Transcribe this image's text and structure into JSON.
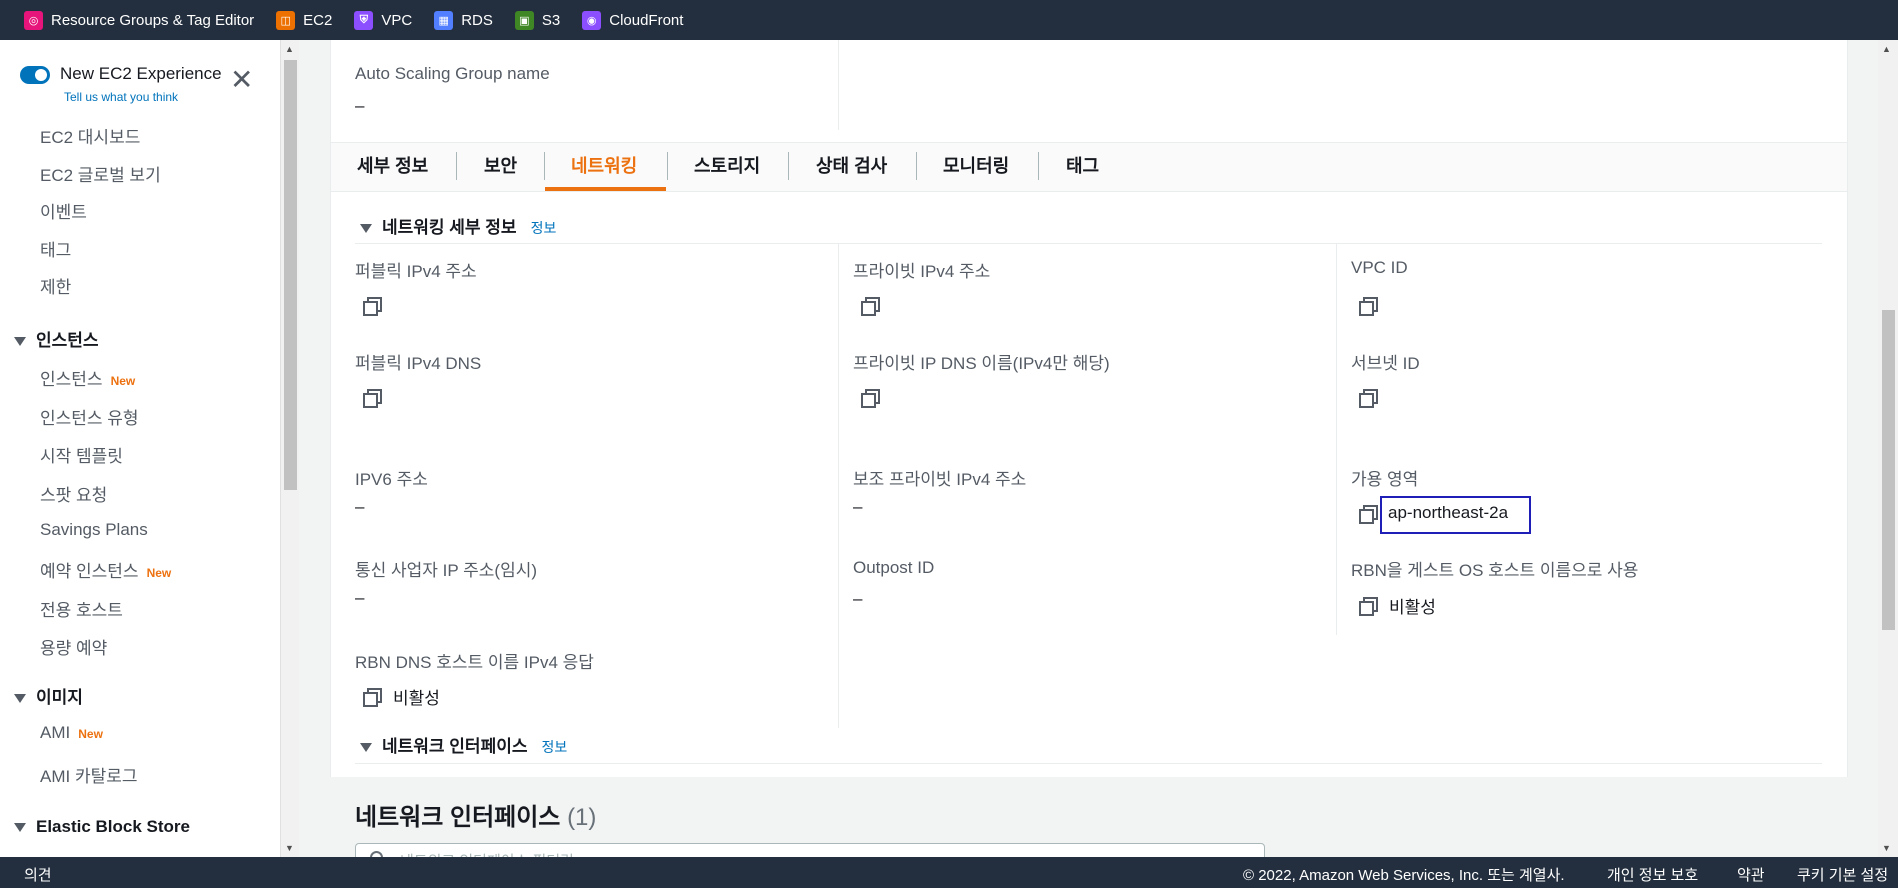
{
  "topbar": {
    "favorites": [
      {
        "label": "Resource Groups & Tag Editor",
        "icon": "resource-groups-icon",
        "color": "#e7157b",
        "glyph": "◎"
      },
      {
        "label": "EC2",
        "icon": "ec2-icon",
        "color": "#ed7100",
        "glyph": "◫"
      },
      {
        "label": "VPC",
        "icon": "vpc-icon",
        "color": "#8c4fff",
        "glyph": "⛨"
      },
      {
        "label": "RDS",
        "icon": "rds-icon",
        "color": "#527fff",
        "glyph": "▦"
      },
      {
        "label": "S3",
        "icon": "s3-icon",
        "color": "#3f8624",
        "glyph": "▣"
      },
      {
        "label": "CloudFront",
        "icon": "cloudfront-icon",
        "color": "#8c4fff",
        "glyph": "◉"
      }
    ]
  },
  "sidebar": {
    "new_experience": {
      "title": "New EC2 Experience",
      "link": "Tell us what you think"
    },
    "items_top": [
      "EC2 대시보드",
      "EC2 글로벌 보기",
      "이벤트",
      "태그",
      "제한"
    ],
    "section_instances": "인스턴스",
    "instances_items": [
      {
        "label": "인스턴스",
        "badge": "New"
      },
      {
        "label": "인스턴스 유형",
        "badge": ""
      },
      {
        "label": "시작 템플릿",
        "badge": ""
      },
      {
        "label": "스팟 요청",
        "badge": ""
      },
      {
        "label": "Savings Plans",
        "badge": ""
      },
      {
        "label": "예약 인스턴스",
        "badge": "New"
      },
      {
        "label": "전용 호스트",
        "badge": ""
      },
      {
        "label": "용량 예약",
        "badge": ""
      }
    ],
    "section_images": "이미지",
    "images_items": [
      {
        "label": "AMI",
        "badge": "New"
      },
      {
        "label": "AMI 카탈로그",
        "badge": ""
      }
    ],
    "section_ebs": "Elastic Block Store"
  },
  "main": {
    "asg_label": "Auto Scaling Group name",
    "asg_value": "–",
    "tabs": [
      "세부 정보",
      "보안",
      "네트워킹",
      "스토리지",
      "상태 검사",
      "모니터링",
      "태그"
    ],
    "active_tab": "네트워킹",
    "networking_section": {
      "title": "네트워킹 세부 정보",
      "info": "정보"
    },
    "fields": {
      "public_ipv4": {
        "label": "퍼블릭 IPv4 주소"
      },
      "private_ipv4": {
        "label": "프라이빗 IPv4 주소"
      },
      "vpc_id": {
        "label": "VPC ID"
      },
      "public_dns": {
        "label": "퍼블릭 IPv4 DNS"
      },
      "private_dns": {
        "label": "프라이빗 IP DNS 이름(IPv4만 해당)"
      },
      "subnet_id": {
        "label": "서브넷 ID"
      },
      "ipv6": {
        "label": "IPV6 주소",
        "value": "–"
      },
      "secondary_private": {
        "label": "보조 프라이빗 IPv4 주소",
        "value": "–"
      },
      "az": {
        "label": "가용 영역",
        "value": "ap-northeast-2a"
      },
      "carrier_ip": {
        "label": "통신 사업자 IP 주소(임시)",
        "value": "–"
      },
      "outpost": {
        "label": "Outpost ID",
        "value": "–"
      },
      "rbn_guest": {
        "label": "RBN을 게스트 OS 호스트 이름으로 사용",
        "value": "비활성"
      },
      "rbn_dns": {
        "label": "RBN DNS 호스트 이름 IPv4 응답",
        "value": "비활성"
      }
    },
    "interfaces_section": {
      "title": "네트워크 인터페이스",
      "info": "정보"
    },
    "ni_title": "네트워크 인터페이스",
    "ni_count": "(1)",
    "ni_search_placeholder": "네트워크 인터페이스 필터링"
  },
  "footer": {
    "feedback": "의견",
    "copyright": "© 2022, Amazon Web Services, Inc. 또는 계열사.",
    "privacy": "개인 정보 보호",
    "terms": "약관",
    "cookies": "쿠키 기본 설정"
  }
}
